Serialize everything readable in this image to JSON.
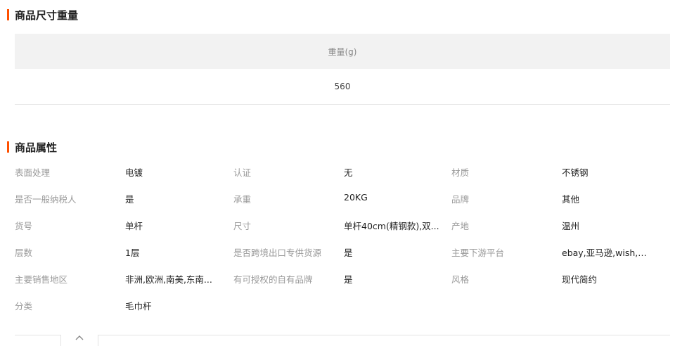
{
  "size_section": {
    "title": "商品尺寸重量",
    "header": "重量(g)",
    "value": "560"
  },
  "attr_section": {
    "title": "商品属性",
    "rows": [
      [
        {
          "label": "表面处理",
          "value": "电镀"
        },
        {
          "label": "认证",
          "value": "无"
        },
        {
          "label": "材质",
          "value": "不锈钢"
        }
      ],
      [
        {
          "label": "是否一般纳税人",
          "value": "是"
        },
        {
          "label": "承重",
          "value": "20KG"
        },
        {
          "label": "品牌",
          "value": "其他"
        }
      ],
      [
        {
          "label": "货号",
          "value": "单杆"
        },
        {
          "label": "尺寸",
          "value": "单杆40cm(精钢款),双..."
        },
        {
          "label": "产地",
          "value": "温州"
        }
      ],
      [
        {
          "label": "层数",
          "value": "1层"
        },
        {
          "label": "是否跨境出口专供货源",
          "value": "是"
        },
        {
          "label": "主要下游平台",
          "value": "ebay,亚马逊,wish,速..."
        }
      ],
      [
        {
          "label": "主要销售地区",
          "value": "非洲,欧洲,南美,东南..."
        },
        {
          "label": "有可授权的自有品牌",
          "value": "是"
        },
        {
          "label": "风格",
          "value": "现代简约"
        }
      ],
      [
        {
          "label": "分类",
          "value": "毛巾杆"
        }
      ]
    ]
  },
  "colors": {
    "accent": "#ff5000"
  },
  "collapse_icon": "chevron-up-icon"
}
